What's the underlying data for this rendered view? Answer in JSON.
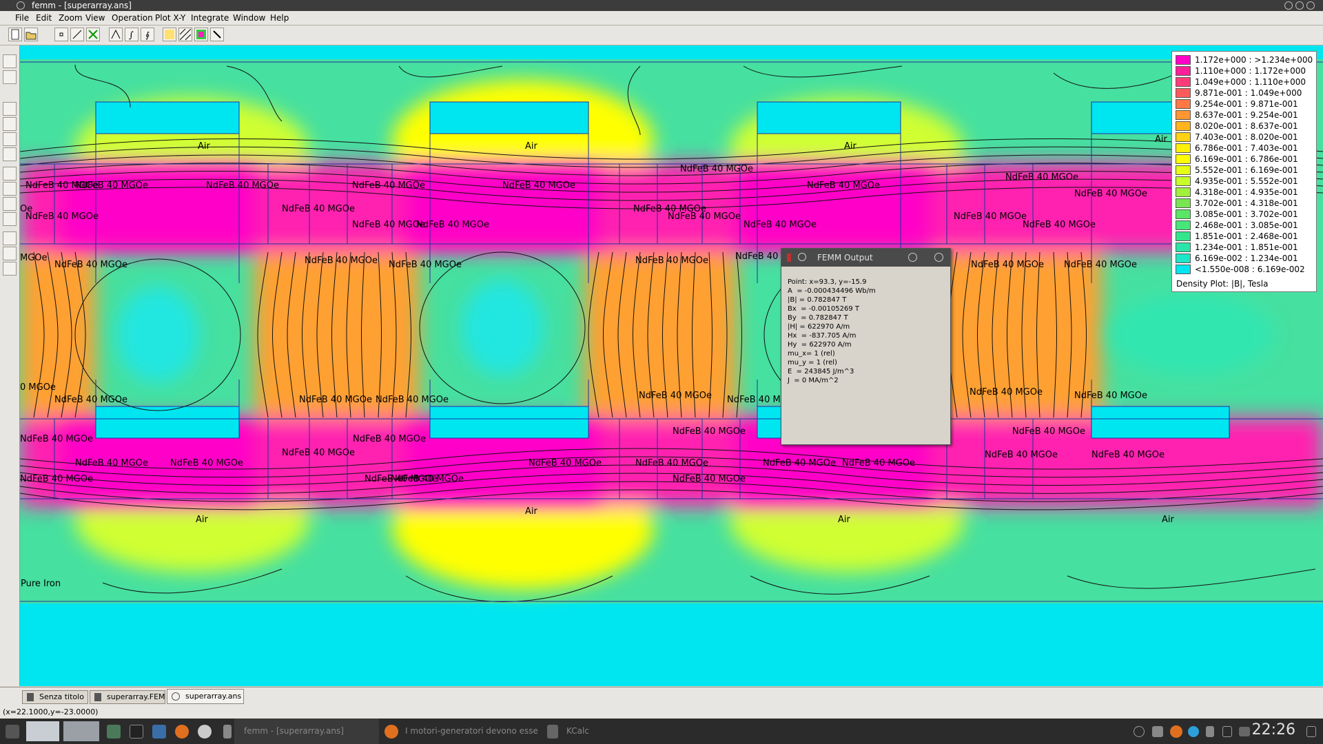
{
  "window": {
    "title": "femm - [superarray.ans]"
  },
  "menu": [
    "File",
    "Edit",
    "Zoom",
    "View",
    "Operation",
    "Plot X-Y",
    "Integrate",
    "Window",
    "Help"
  ],
  "plot_labels": {
    "air": "Air",
    "magnet": "NdFeB 40 MGOe",
    "magnet_cut_a": "Oe",
    "magnet_cut_b": "MGOe",
    "magnet_cut_c": "NdFeB 40",
    "magnet_cut_d": "NdFeB 40 M",
    "magnet_cut_e": "0 MGOe",
    "iron": "Pure Iron"
  },
  "legend": {
    "title": "Density Plot: |B|, Tesla",
    "rows": [
      {
        "range": "1.172e+000 : >1.234e+000",
        "color": "#ff00c8"
      },
      {
        "range": "1.110e+000 : 1.172e+000",
        "color": "#ff1e9a"
      },
      {
        "range": "1.049e+000 : 1.110e+000",
        "color": "#ff3c78"
      },
      {
        "range": "9.871e-001 : 1.049e+000",
        "color": "#ff5a5a"
      },
      {
        "range": "9.254e-001 : 9.871e-001",
        "color": "#ff7846"
      },
      {
        "range": "8.637e-001 : 9.254e-001",
        "color": "#ff9632"
      },
      {
        "range": "8.020e-001 : 8.637e-001",
        "color": "#ffb41e"
      },
      {
        "range": "7.403e-001 : 8.020e-001",
        "color": "#ffd214"
      },
      {
        "range": "6.786e-001 : 7.403e-001",
        "color": "#fff00a"
      },
      {
        "range": "6.169e-001 : 6.786e-001",
        "color": "#ffff00"
      },
      {
        "range": "5.552e-001 : 6.169e-001",
        "color": "#e6ff14"
      },
      {
        "range": "4.935e-001 : 5.552e-001",
        "color": "#c8ff28"
      },
      {
        "range": "4.318e-001 : 4.935e-001",
        "color": "#a0f03c"
      },
      {
        "range": "3.702e-001 : 4.318e-001",
        "color": "#78e650"
      },
      {
        "range": "3.085e-001 : 3.702e-001",
        "color": "#5ae664"
      },
      {
        "range": "2.468e-001 : 3.085e-001",
        "color": "#46e678"
      },
      {
        "range": "1.851e-001 : 2.468e-001",
        "color": "#32e68c"
      },
      {
        "range": "1.234e-001 : 1.851e-001",
        "color": "#28e6aa"
      },
      {
        "range": "6.169e-002 : 1.234e-001",
        "color": "#1ee6c8"
      },
      {
        "range": "<1.550e-008 : 6.169e-002",
        "color": "#00e6f0"
      }
    ]
  },
  "output": {
    "title": "FEMM Output",
    "lines": [
      "Point: x=93.3, y=-15.9",
      "A  = -0.000434496 Wb/m",
      "|B| = 0.782847 T",
      "Bx  = -0.00105269 T",
      "By  = 0.782847 T",
      "|H| = 622970 A/m",
      "Hx  = -837.705 A/m",
      "Hy  = 622970 A/m",
      "mu_x= 1 (rel)",
      "mu_y = 1 (rel)",
      "E  = 243845 J/m^3",
      "J  = 0 MA/m^2"
    ]
  },
  "tabs": [
    {
      "label": "Senza titolo"
    },
    {
      "label": "superarray.FEM"
    },
    {
      "label": "superarray.ans"
    }
  ],
  "status": {
    "coords": "(x=22.1000,y=-23.0000)"
  },
  "taskbar": {
    "apps": [
      {
        "label": "femm - [superarray.ans]"
      },
      {
        "label": "I motori-generatori devono essere"
      },
      {
        "label": "KCalc"
      }
    ],
    "clock": "22:26"
  },
  "colors": {
    "background_field": "#00e6f0",
    "high_field": "#ff00c8",
    "mid_field": "#ffff00"
  }
}
